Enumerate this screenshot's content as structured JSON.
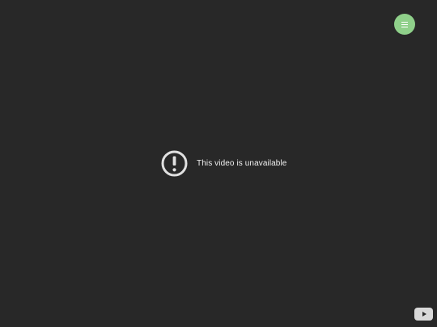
{
  "player": {
    "message": "This video is unavailable"
  },
  "icons": {
    "menu": "menu-icon",
    "alert": "alert-circle-icon",
    "logo": "youtube-play-icon"
  },
  "colors": {
    "background": "#282828",
    "menu_button": "#8fd08a",
    "text": "#f1f1f1",
    "logo_background": "#d9d9d9",
    "logo_play": "#282828"
  }
}
